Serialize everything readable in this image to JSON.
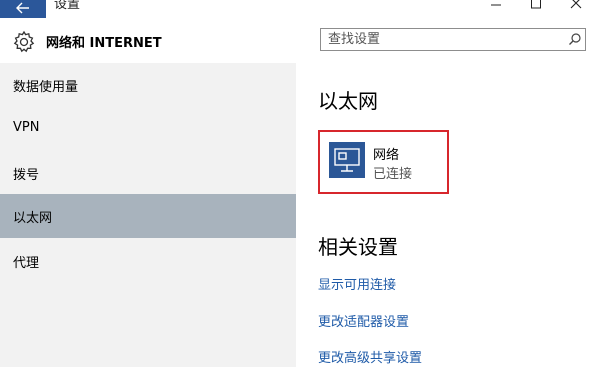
{
  "titlebar": {
    "title": "设置",
    "back_icon": "back-arrow-icon",
    "min_icon": "minimize-icon",
    "max_icon": "maximize-icon",
    "close_icon": "close-icon"
  },
  "left": {
    "header_icon": "gear-icon",
    "header_title": "网络和 INTERNET",
    "items": [
      {
        "label": "数据使用量",
        "selected": false
      },
      {
        "label": "VPN",
        "selected": false
      },
      {
        "label": "拨号",
        "selected": false
      },
      {
        "label": "以太网",
        "selected": true
      },
      {
        "label": "代理",
        "selected": false
      }
    ]
  },
  "right": {
    "search": {
      "placeholder": "查找设置",
      "value": "",
      "icon": "search-icon"
    },
    "section_title": "以太网",
    "network": {
      "name": "网络",
      "status": "已连接",
      "icon": "ethernet-icon"
    },
    "related_title": "相关设置",
    "links": [
      "显示可用连接",
      "更改适配器设置",
      "更改高级共享设置"
    ]
  },
  "colors": {
    "accent": "#2b579a",
    "selected_bg": "#a8b3bd",
    "pane_bg": "#f2f2f2",
    "highlight_border": "#d7262c",
    "link": "#1f5ba8"
  }
}
